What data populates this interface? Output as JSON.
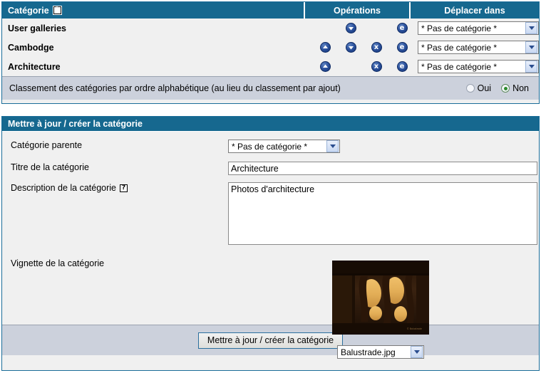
{
  "categories_panel": {
    "columns": {
      "name": "Catégorie",
      "name_help_icon": "help-question-icon",
      "operations": "Opérations",
      "move_to": "Déplacer dans"
    },
    "rows": [
      {
        "name": "User galleries",
        "ops": {
          "up": false,
          "down": true,
          "delete": false,
          "edit": true
        },
        "move_select": "* Pas de catégorie *"
      },
      {
        "name": "Cambodge",
        "ops": {
          "up": true,
          "down": true,
          "delete": true,
          "edit": true
        },
        "move_select": "* Pas de catégorie *"
      },
      {
        "name": "Architecture",
        "ops": {
          "up": true,
          "down": false,
          "delete": true,
          "edit": true
        },
        "move_select": "* Pas de catégorie *"
      }
    ],
    "alpha_sort": {
      "label": "Classement des catégories par ordre alphabétique (au lieu du classement par ajout)",
      "yes_label": "Oui",
      "no_label": "Non",
      "selected": "Non"
    }
  },
  "form_panel": {
    "title": "Mettre à jour / créer la catégorie",
    "parent_label": "Catégorie parente",
    "parent_value": "* Pas de catégorie *",
    "title_label": "Titre de la catégorie",
    "title_value": "Architecture",
    "description_label": "Description de la catégorie",
    "description_help_icon": "help-question-icon",
    "description_value": "Photos d'architecture",
    "thumbnail_label": "Vignette de la catégorie",
    "thumbnail_file": "Balustrade.jpg",
    "submit_label": "Mettre à jour / créer la catégorie"
  },
  "icons": {
    "move_up": "arrow-up-icon",
    "move_down": "arrow-down-icon",
    "delete": "delete-x-icon",
    "edit": "edit-e-icon",
    "dropdown": "chevron-down-icon"
  },
  "colors": {
    "header_blue": "#16688f",
    "panel_bg": "#f0f0f0",
    "bar_bg": "#ccd1dc",
    "icon_blue": "#2f55a0",
    "radio_green": "#2d8b2d"
  }
}
